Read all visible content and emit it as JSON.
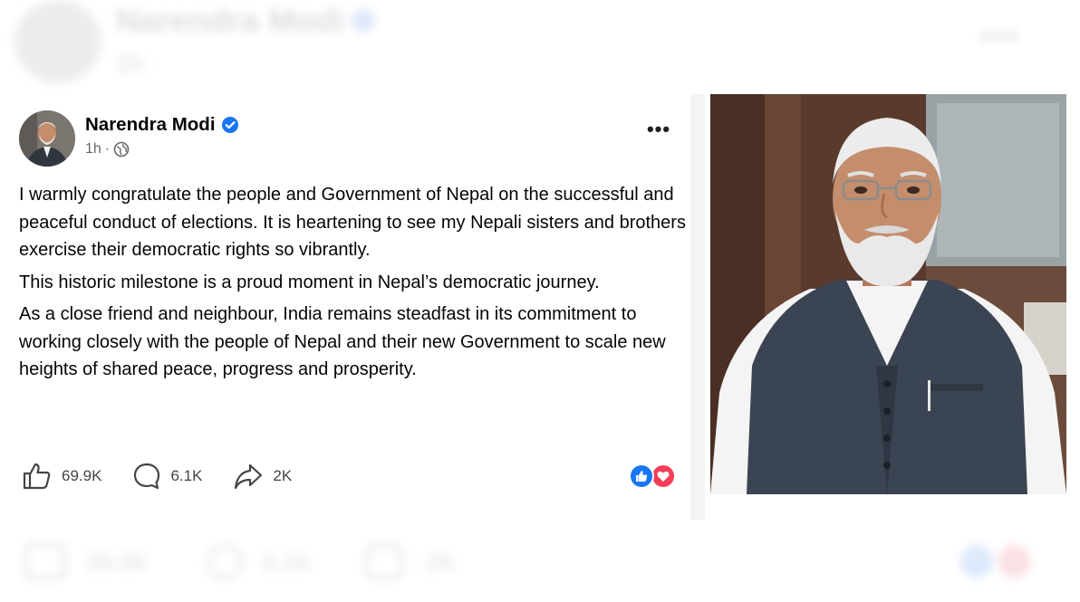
{
  "background_ghost": {
    "name": "Narendra Modi",
    "time": "1h ·",
    "counts": [
      "69.9K",
      "6.1K",
      "2K"
    ]
  },
  "post": {
    "author": "Narendra Modi",
    "verified": true,
    "time": "1h",
    "separator": "·",
    "visibility_icon": "globe-icon",
    "more_label": "•••",
    "paragraphs": [
      "I warmly congratulate the people and Government of Nepal on the successful and peaceful conduct of elections. It is heartening to see my Nepali sisters and brothers exercise their democratic rights so vibrantly.",
      "This historic milestone is a proud moment in Nepal’s democratic journey.",
      "As a close friend and neighbour, India remains steadfast in its commitment to working closely with the people of Nepal and their new Government to scale new heights of shared peace, progress and prosperity."
    ],
    "actions": {
      "like": {
        "icon": "thumbs-up-icon",
        "count": "69.9K"
      },
      "comment": {
        "icon": "comment-bubble-icon",
        "count": "6.1K"
      },
      "share": {
        "icon": "share-arrow-icon",
        "count": "2K"
      }
    },
    "reactions": [
      "like-reaction-icon",
      "love-reaction-icon"
    ]
  },
  "colors": {
    "facebook_blue": "#1877f2",
    "love_red": "#f33e58",
    "meta_gray": "#65676b",
    "text": "#050505"
  }
}
